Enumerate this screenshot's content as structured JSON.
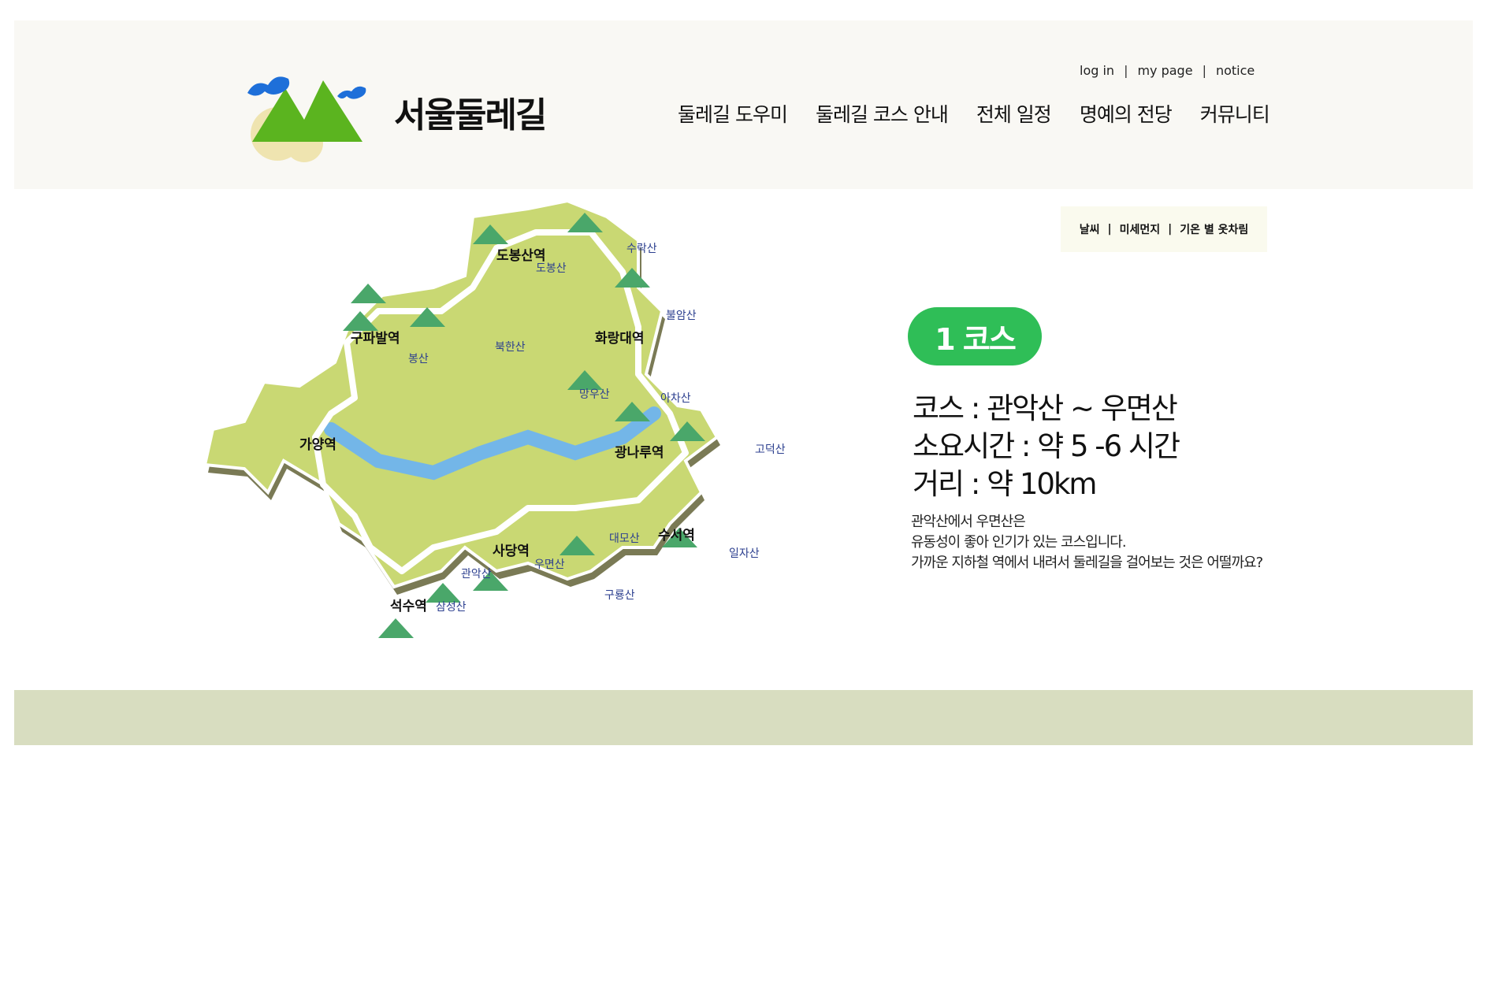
{
  "header": {
    "site_title": "서울둘레길",
    "util_links": [
      "log in",
      "my page",
      "notice"
    ],
    "nav": [
      "둘레길 도우미",
      "둘레길 코스 안내",
      "전체 일정",
      "명예의 전당",
      "커뮤니티"
    ]
  },
  "weather_bar": {
    "items": [
      "날씨",
      "미세먼지",
      "기온 별 옷차림"
    ]
  },
  "course": {
    "badge": "1 코스",
    "route": "코스 : 관악산 ~ 우면산",
    "duration": "소요시간 : 약 5 -6 시간",
    "distance": "거리 : 약 10km",
    "desc_lines": [
      "관악산에서 우면산은",
      "유동성이 좋아 인기가 있는 코스입니다.",
      "가까운 지하철 역에서 내려서 둘레길을 걸어보는 것은 어떨까요?"
    ]
  },
  "map": {
    "stations": [
      "도봉산역",
      "구파발역",
      "화랑대역",
      "가양역",
      "광나루역",
      "사당역",
      "수서역",
      "석수역"
    ],
    "mountains": [
      "수락산",
      "도봉산",
      "북한산",
      "봉산",
      "불암산",
      "망우산",
      "아차산",
      "고덕산",
      "대모산",
      "일자산",
      "우면산",
      "관악산",
      "삼성산",
      "구룡산"
    ]
  },
  "colors": {
    "header_bg": "#f9f8f4",
    "badge_green": "#2fbe57",
    "footer_band": "#d8ddc0",
    "map_land": "#c9d873",
    "river": "#73b6e8"
  }
}
